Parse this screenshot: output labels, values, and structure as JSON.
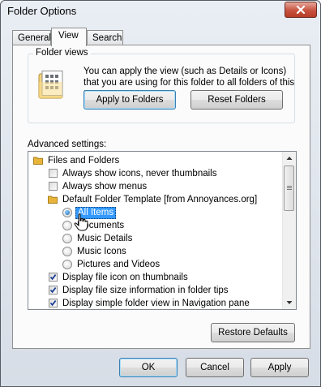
{
  "window": {
    "title": "Folder Options",
    "close_icon": "close-icon"
  },
  "tabs": [
    {
      "label": "General",
      "active": false
    },
    {
      "label": "View",
      "active": true
    },
    {
      "label": "Search",
      "active": false
    }
  ],
  "folder_views": {
    "legend": "Folder views",
    "description": "You can apply the view (such as Details or Icons) that you are using for this folder to all folders of this type.",
    "apply_button": "Apply to Folders",
    "reset_button": "Reset Folders",
    "icon": "folder-views-icon"
  },
  "advanced": {
    "label": "Advanced settings:",
    "items": [
      {
        "type": "folder",
        "label": "Files and Folders"
      },
      {
        "type": "checkbox",
        "label": "Always show icons, never thumbnails",
        "checked": false
      },
      {
        "type": "checkbox",
        "label": "Always show menus",
        "checked": false
      },
      {
        "type": "folder",
        "label": "Default Folder Template [from Annoyances.org]"
      },
      {
        "type": "radio",
        "label": "All Items",
        "checked": true,
        "selected": true
      },
      {
        "type": "radio",
        "label": "Documents",
        "checked": false
      },
      {
        "type": "radio",
        "label": "Music Details",
        "checked": false
      },
      {
        "type": "radio",
        "label": "Music Icons",
        "checked": false
      },
      {
        "type": "radio",
        "label": "Pictures and Videos",
        "checked": false
      },
      {
        "type": "checkbox",
        "label": "Display file icon on thumbnails",
        "checked": true
      },
      {
        "type": "checkbox",
        "label": "Display file size information in folder tips",
        "checked": true
      },
      {
        "type": "checkbox",
        "label": "Display simple folder view in Navigation pane",
        "checked": true
      }
    ]
  },
  "restore_button": "Restore Defaults",
  "footer": {
    "ok": "OK",
    "cancel": "Cancel",
    "apply": "Apply"
  },
  "colors": {
    "selection": "#3399ff",
    "checkmark": "#1c3f94",
    "folder": "#e8b53a"
  }
}
